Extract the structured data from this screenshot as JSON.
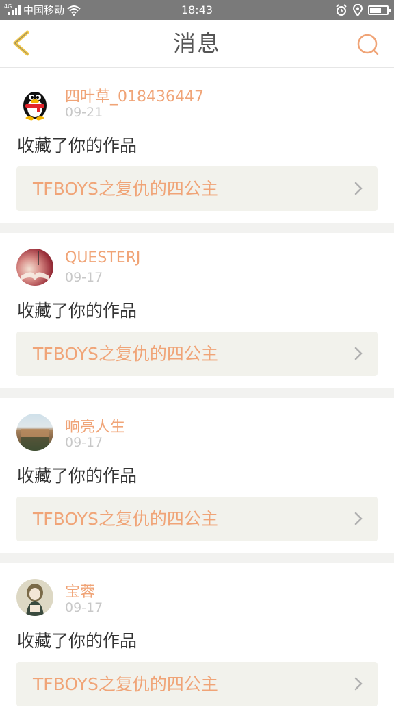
{
  "statusbar": {
    "carrier": "中国移动",
    "network": "4G",
    "time": "18:43",
    "battery_level": 0.6
  },
  "header": {
    "title": "消息",
    "back_icon": "chevron-left-icon",
    "search_icon": "search-icon"
  },
  "colors": {
    "accent": "#f0a477",
    "back_icon": "#f2c94c",
    "text": "#333333",
    "muted": "#c8c8c8",
    "card_bg": "#f2f2ec"
  },
  "messages": [
    {
      "username": "四叶草_018436447",
      "date": "09-21",
      "action": "收藏了你的作品",
      "work_title": "TFBOYS之复仇的四公主",
      "avatar": "qq-penguin-avatar"
    },
    {
      "username": "QUESTERJ",
      "date": "09-17",
      "action": "收藏了你的作品",
      "work_title": "TFBOYS之复仇的四公主",
      "avatar": "book-photo-avatar"
    },
    {
      "username": "响亮人生",
      "date": "09-17",
      "action": "收藏了你的作品",
      "work_title": "TFBOYS之复仇的四公主",
      "avatar": "landscape-photo-avatar"
    },
    {
      "username": "宝蓉",
      "date": "09-17",
      "action": "收藏了你的作品",
      "work_title": "TFBOYS之复仇的四公主",
      "avatar": "anime-girl-avatar"
    }
  ]
}
